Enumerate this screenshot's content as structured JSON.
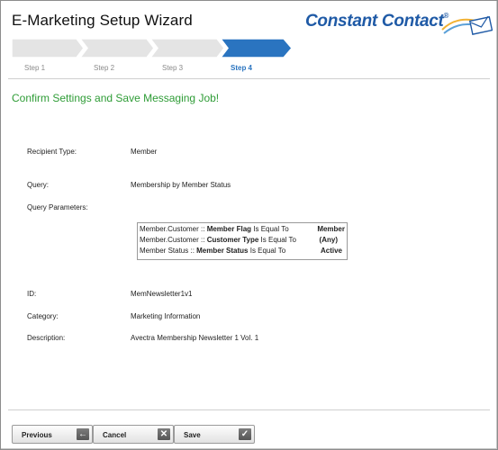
{
  "window": {
    "title": "E-Marketing Setup Wizard"
  },
  "logo": {
    "text": "Constant Contact",
    "mark": "®",
    "icon": "envelope-swoosh-icon"
  },
  "steps": [
    {
      "label": "Step 1",
      "active": false
    },
    {
      "label": "Step 2",
      "active": false
    },
    {
      "label": "Step 3",
      "active": false
    },
    {
      "label": "Step 4",
      "active": true
    }
  ],
  "main": {
    "heading": "Confirm Settings and Save Messaging Job!",
    "fields": {
      "recipient_type": {
        "label": "Recipient Type:",
        "value": "Member"
      },
      "query": {
        "label": "Query:",
        "value": "Membership by Member Status"
      },
      "query_parameters": {
        "label": "Query Parameters:"
      },
      "id": {
        "label": "ID:",
        "value": "MemNewsletter1v1"
      },
      "category": {
        "label": "Category:",
        "value": "Marketing Information"
      },
      "description": {
        "label": "Description:",
        "value": "Avectra Membership Newsletter 1 Vol. 1"
      }
    },
    "query_params": [
      {
        "prefix": "Member.Customer :: ",
        "field": "Member Flag",
        "operator": " Is Equal To",
        "value": "Member"
      },
      {
        "prefix": "Member.Customer :: ",
        "field": "Customer Type",
        "operator": " Is Equal To",
        "value": "(Any)"
      },
      {
        "prefix": "Member Status :: ",
        "field": "Member Status",
        "operator": " Is Equal To",
        "value": "Active"
      }
    ]
  },
  "buttons": {
    "previous": {
      "label": "Previous",
      "icon": "arrow-left-icon"
    },
    "cancel": {
      "label": "Cancel",
      "icon": "close-icon"
    },
    "save": {
      "label": "Save",
      "icon": "checkmark-icon"
    }
  },
  "colors": {
    "step_active": "#2a74c0",
    "step_inactive": "#e4e4e4",
    "heading": "#2e9c36",
    "logo": "#1f5aa6"
  }
}
